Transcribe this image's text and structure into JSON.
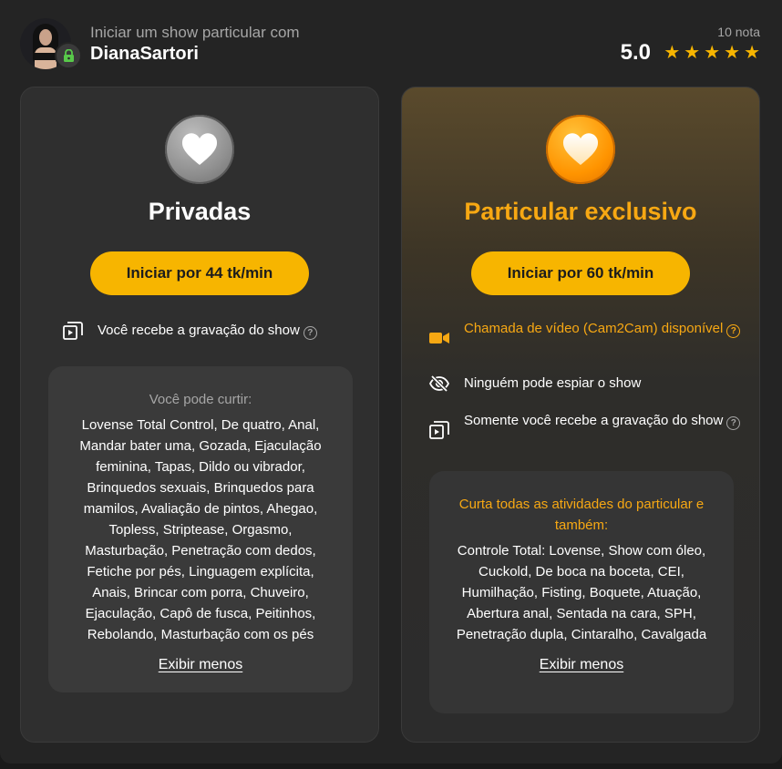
{
  "header": {
    "subtitle": "Iniciar um show particular com",
    "model_name": "DianaSartori",
    "rating_count": "10 nota",
    "rating_value": "5.0",
    "stars": 5
  },
  "cards": [
    {
      "title": "Privadas",
      "button_label": "Iniciar por 44 tk/min",
      "features": [
        {
          "icon": "recording-icon",
          "text": "Você recebe a gravação do show",
          "help": "?"
        }
      ],
      "box_heading": "Você pode curtir:",
      "box_text": "Lovense Total Control, De quatro, Anal, Mandar bater uma, Gozada, Ejaculação feminina, Tapas, Dildo ou vibrador, Brinquedos sexuais, Brinquedos para mamilos, Avaliação de pintos, Ahegao, Topless, Striptease, Orgasmo, Masturbação, Penetração com dedos, Fetiche por pés, Linguagem explícita, Anais, Brincar com porra, Chuveiro, Ejaculação, Capô de fusca, Peitinhos, Rebolando, Masturbação com os pés",
      "show_less": "Exibir menos"
    },
    {
      "title": "Particular exclusivo",
      "button_label": "Iniciar por 60 tk/min",
      "features": [
        {
          "icon": "video-camera-icon",
          "text": "Chamada de vídeo (Cam2Cam) disponível",
          "help": "?"
        },
        {
          "icon": "eye-off-icon",
          "text": "Ninguém pode espiar o show"
        },
        {
          "icon": "recording-icon",
          "text": "Somente você recebe a gravação do show",
          "help": "?"
        }
      ],
      "box_heading": "Curta todas as atividades do particular e também:",
      "box_text": "Controle Total: Lovense, Show com óleo, Cuckold, De boca na boceta, CEI, Humilhação, Fisting, Boquete, Atuação, Abertura anal, Sentada na cara, SPH, Penetração dupla, Cintaralho, Cavalgada",
      "show_less": "Exibir menos"
    }
  ],
  "colors": {
    "accent": "#f7b500",
    "accent_text": "#f7a813",
    "background": "#242424",
    "card": "#2f2f2f"
  }
}
